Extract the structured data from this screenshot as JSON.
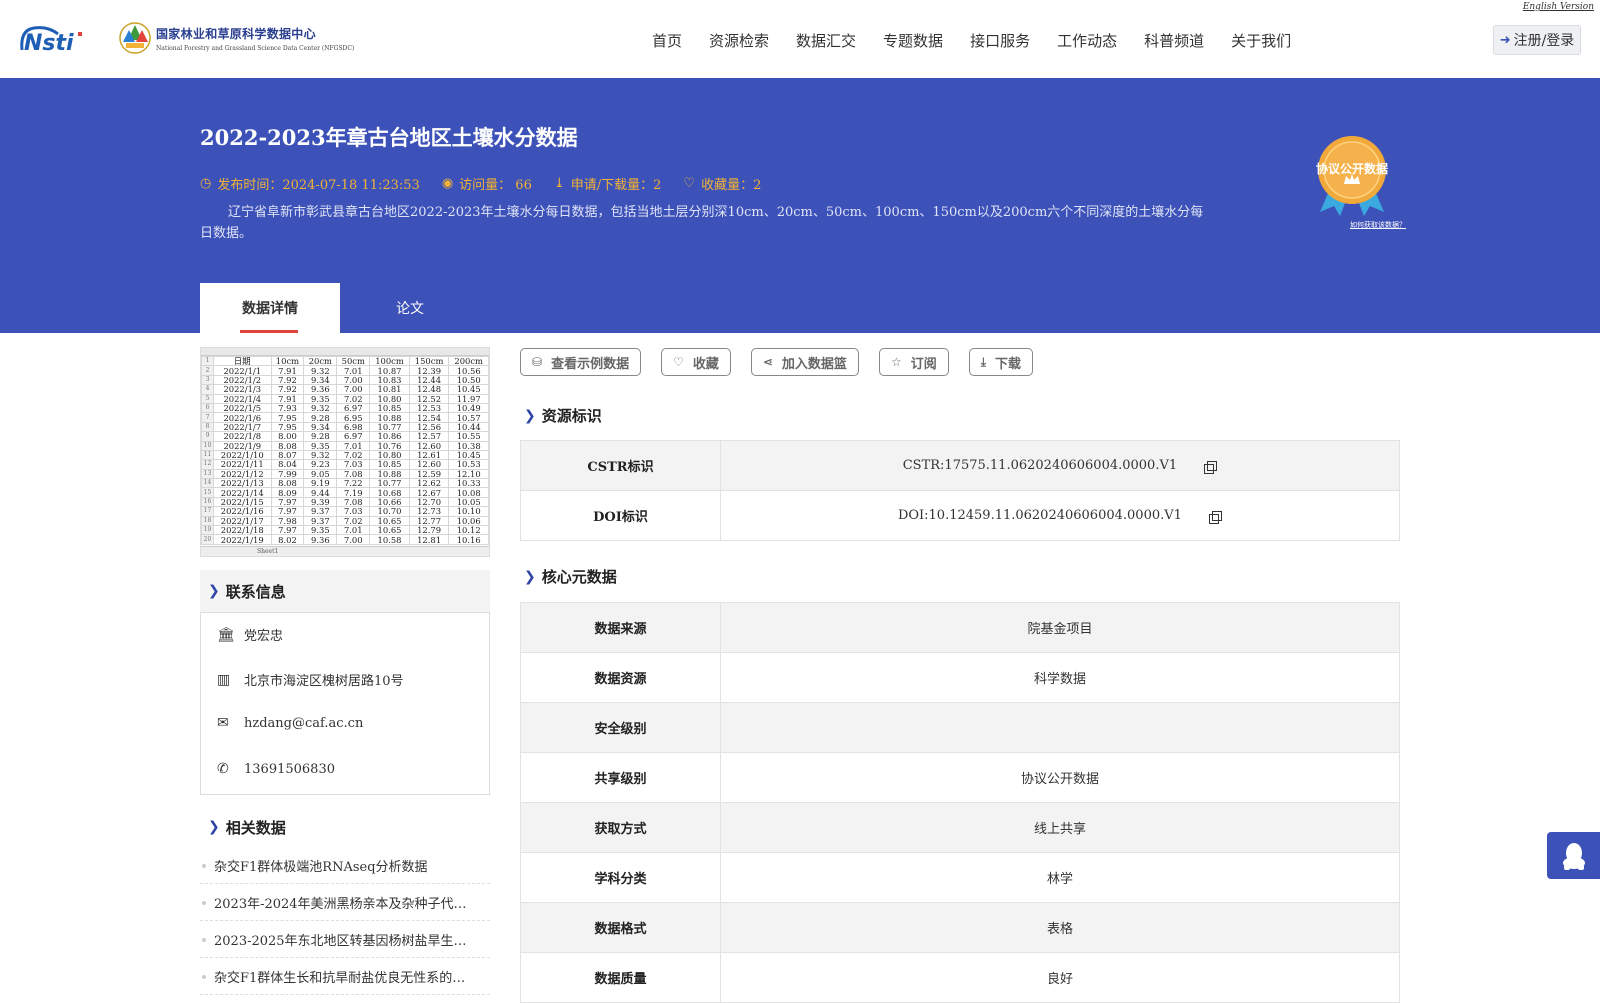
{
  "header": {
    "english_link": "English Version",
    "org_name_cn": "国家林业和草原科学数据中心",
    "org_name_en": "National Forestry and Grassland Science Data Center (NFGSDC)",
    "nav": [
      "首页",
      "资源检索",
      "数据汇交",
      "专题数据",
      "接口服务",
      "工作动态",
      "科普频道",
      "关于我们"
    ],
    "login_label": "注册/登录"
  },
  "banner": {
    "title": "2022-2023年章古台地区土壤水分数据",
    "publish_time": "发布时间：2024-07-18 11:23:53",
    "visits": "访问量： 66",
    "downloads": "申请/下载量：2",
    "favorites": "收藏量：2",
    "description": "辽宁省阜新市彰武县章古台地区2022-2023年土壤水分每日数据，包括当地土层分别深10cm、20cm、50cm、100cm、150cm以及200cm六个不同深度的土壤水分每日数据。",
    "badge_text": "协议公开数据",
    "badge_help": "如何获取该数据？",
    "accent_color": "#f2b235",
    "banner_color": "#3d52b8"
  },
  "tabs": [
    {
      "label": "数据详情",
      "active": true
    },
    {
      "label": "论文",
      "active": false
    }
  ],
  "preview": {
    "header": [
      "日期",
      "10cm",
      "20cm",
      "50cm",
      "100cm",
      "150cm",
      "200cm"
    ],
    "rows": [
      [
        "2022/1/1",
        "7.91",
        "9.32",
        "7.01",
        "10.87",
        "12.39",
        "10.56"
      ],
      [
        "2022/1/2",
        "7.92",
        "9.34",
        "7.00",
        "10.83",
        "12.44",
        "10.50"
      ],
      [
        "2022/1/3",
        "7.92",
        "9.36",
        "7.00",
        "10.81",
        "12.48",
        "10.45"
      ],
      [
        "2022/1/4",
        "7.91",
        "9.35",
        "7.02",
        "10.80",
        "12.52",
        "11.97"
      ],
      [
        "2022/1/5",
        "7.93",
        "9.32",
        "6.97",
        "10.85",
        "12.53",
        "10.49"
      ],
      [
        "2022/1/6",
        "7.95",
        "9.28",
        "6.95",
        "10.88",
        "12.54",
        "10.57"
      ],
      [
        "2022/1/7",
        "7.95",
        "9.34",
        "6.98",
        "10.77",
        "12.56",
        "10.44"
      ],
      [
        "2022/1/8",
        "8.00",
        "9.28",
        "6.97",
        "10.86",
        "12.57",
        "10.55"
      ],
      [
        "2022/1/9",
        "8.08",
        "9.35",
        "7.01",
        "10.76",
        "12.60",
        "10.38"
      ],
      [
        "2022/1/10",
        "8.07",
        "9.32",
        "7.02",
        "10.80",
        "12.61",
        "10.45"
      ],
      [
        "2022/1/11",
        "8.04",
        "9.23",
        "7.03",
        "10.85",
        "12.60",
        "10.53"
      ],
      [
        "2022/1/12",
        "7.99",
        "9.05",
        "7.08",
        "10.88",
        "12.59",
        "12.10"
      ],
      [
        "2022/1/13",
        "8.08",
        "9.19",
        "7.22",
        "10.77",
        "12.62",
        "10.33"
      ],
      [
        "2022/1/14",
        "8.09",
        "9.44",
        "7.19",
        "10.68",
        "12.67",
        "10.08"
      ],
      [
        "2022/1/15",
        "7.97",
        "9.39",
        "7.08",
        "10.66",
        "12.70",
        "10.05"
      ],
      [
        "2022/1/16",
        "7.97",
        "9.37",
        "7.03",
        "10.70",
        "12.73",
        "10.10"
      ],
      [
        "2022/1/17",
        "7.98",
        "9.37",
        "7.02",
        "10.65",
        "12.77",
        "10.06"
      ],
      [
        "2022/1/18",
        "7.97",
        "9.35",
        "7.01",
        "10.65",
        "12.79",
        "10.12"
      ],
      [
        "2022/1/19",
        "8.02",
        "9.36",
        "7.00",
        "10.58",
        "12.81",
        "10.16"
      ]
    ],
    "sheet_tab": "Sheet1"
  },
  "contact": {
    "title": "联系信息",
    "name": "党宏忠",
    "address": "北京市海淀区槐树居路10号",
    "email": "hzdang@caf.ac.cn",
    "phone": "13691506830"
  },
  "related": {
    "title": "相关数据",
    "items": [
      "杂交F1群体极端池RNAseq分析数据",
      "2023年-2024年美洲黑杨亲本及杂种子代…",
      "2023-2025年东北地区转基因杨树盐旱生…",
      "杂交F1群体生长和抗旱耐盐优良无性系的…"
    ]
  },
  "actions": [
    "查看示例数据",
    "收藏",
    "加入数据篮",
    "订阅",
    "下载"
  ],
  "resource_id": {
    "title": "资源标识",
    "rows": [
      {
        "label": "CSTR标识",
        "value": "CSTR:17575.11.0620240606004.0000.V1"
      },
      {
        "label": "DOI标识",
        "value": "DOI:10.12459.11.0620240606004.0000.V1"
      }
    ]
  },
  "core_meta": {
    "title": "核心元数据",
    "rows": [
      {
        "label": "数据来源",
        "value": "院基金项目"
      },
      {
        "label": "数据资源",
        "value": "科学数据"
      },
      {
        "label": "安全级别",
        "value": ""
      },
      {
        "label": "共享级别",
        "value": "协议公开数据"
      },
      {
        "label": "获取方式",
        "value": "线上共享"
      },
      {
        "label": "学科分类",
        "value": "林学"
      },
      {
        "label": "数据格式",
        "value": "表格"
      },
      {
        "label": "数据质量",
        "value": "良好"
      }
    ]
  }
}
